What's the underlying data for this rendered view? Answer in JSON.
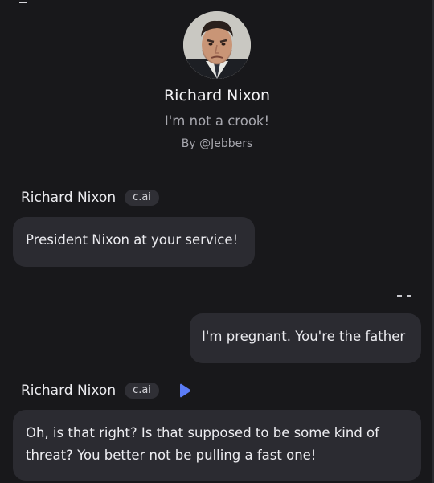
{
  "character": {
    "name": "Richard Nixon",
    "tagline": "I'm not a crook!",
    "author": "By @Jebbers"
  },
  "messages": [
    {
      "sender": "Richard Nixon",
      "badge": "c.ai",
      "text": "President Nixon at your service!"
    },
    {
      "sender": "user",
      "text": "I'm pregnant. You're the father"
    },
    {
      "sender": "Richard Nixon",
      "badge": "c.ai",
      "text": "Oh, is that right?  Is that supposed to be some kind of threat?  You better not be pulling a fast one!"
    }
  ],
  "colors": {
    "background": "#18181b",
    "bubble": "#2b2b31",
    "badge": "#2f2f35",
    "play_accent": "#5b7cf7",
    "muted_text": "#a7a7ae"
  },
  "icons": {
    "avatar": "nixon-portrait",
    "play": "play-icon",
    "user_avatar_placeholder": "dashes-icon"
  }
}
